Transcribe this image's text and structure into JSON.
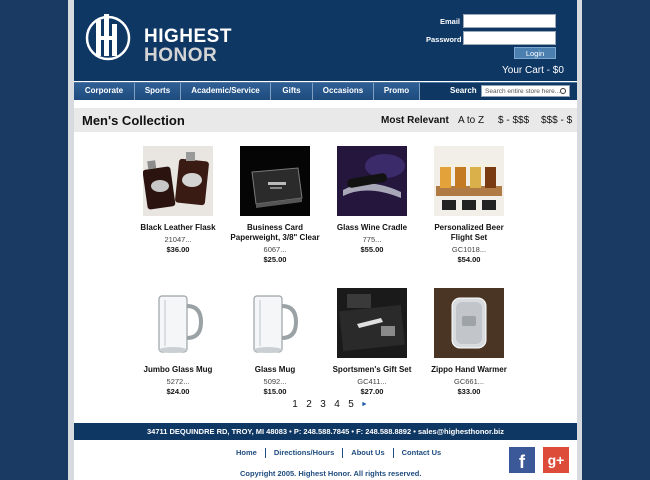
{
  "header": {
    "logo_line1": "HIGHEST",
    "logo_line2": "HONOR",
    "email_label": "Email",
    "password_label": "Password",
    "login_label": "Login",
    "cart_label": "Your Cart - $0"
  },
  "nav": {
    "items": [
      {
        "label": "Corporate"
      },
      {
        "label": "Sports"
      },
      {
        "label": "Academic/Service"
      },
      {
        "label": "Gifts"
      },
      {
        "label": "Occasions"
      },
      {
        "label": "Promo"
      }
    ],
    "search_label": "Search",
    "search_placeholder": "Search entire store here..."
  },
  "collection": {
    "title": "Men's Collection",
    "sort_options": [
      "Most Relevant",
      "A to Z",
      "$ - $$$",
      "$$$ - $"
    ]
  },
  "products": [
    {
      "name": "Black Leather Flask",
      "sku": "21047...",
      "price": "$36.00",
      "icon": "flask-image"
    },
    {
      "name": "Business Card Paperweight, 3/8\" Clear",
      "sku": "6067...",
      "price": "$25.00",
      "icon": "paperweight-image"
    },
    {
      "name": "Glass Wine Cradle",
      "sku": "775...",
      "price": "$55.00",
      "icon": "wine-cradle-image"
    },
    {
      "name": "Personalized Beer Flight Set",
      "sku": "GC1018...",
      "price": "$54.00",
      "icon": "beer-flight-image"
    },
    {
      "name": "Jumbo Glass Mug",
      "sku": "5272...",
      "price": "$24.00",
      "icon": "mug-image"
    },
    {
      "name": "Glass Mug",
      "sku": "5092...",
      "price": "$15.00",
      "icon": "mug-image"
    },
    {
      "name": "Sportsmen's Gift Set",
      "sku": "GC411...",
      "price": "$27.00",
      "icon": "gift-set-image"
    },
    {
      "name": "Zippo Hand Warmer",
      "sku": "GC661...",
      "price": "$33.00",
      "icon": "hand-warmer-image"
    }
  ],
  "pagination": {
    "pages": [
      "1",
      "2",
      "3",
      "4",
      "5"
    ],
    "next_label": "►"
  },
  "footer": {
    "contact": "34711 DEQUINDRE RD, TROY, MI 48083   •   P: 248.588.7845   •   F: 248.588.8892   •   sales@highesthonor.biz",
    "links": [
      "Home",
      "Directions/Hours",
      "About Us",
      "Contact Us"
    ],
    "copyright": "Copyright 2005. Highest Honor. All rights reserved.",
    "facebook_label": "f",
    "googleplus_label": "g+"
  },
  "colors": {
    "brand_navy": "#0e3764",
    "page_background": "#1b3a63",
    "link_blue": "#1e4b7e",
    "facebook": "#3b5998",
    "googleplus": "#dd4b39"
  }
}
